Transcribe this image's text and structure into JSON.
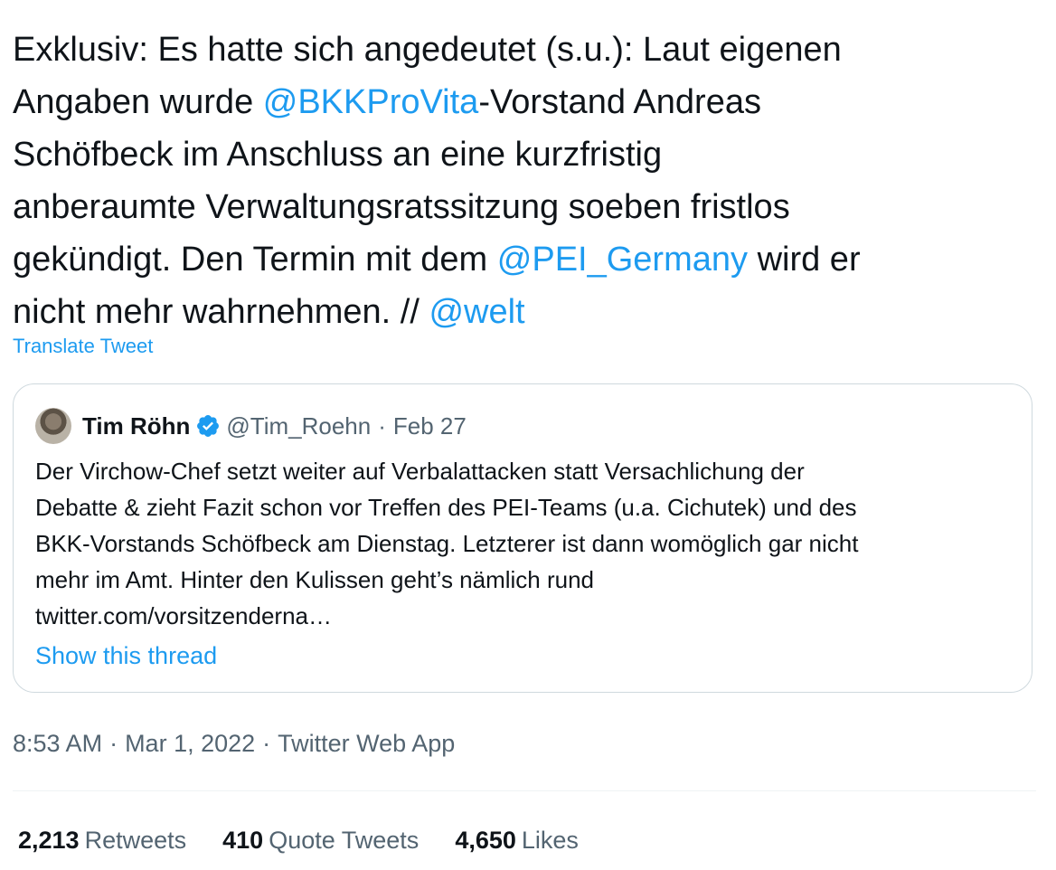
{
  "tweet": {
    "text_lines": [
      [
        {
          "t": "Exklusiv: Es hatte sich angedeutet (s.u.): Laut eigenen",
          "mention": false
        }
      ],
      [
        {
          "t": "Angaben wurde ",
          "mention": false
        },
        {
          "t": "@BKKProVita",
          "mention": true
        },
        {
          "t": "-Vorstand Andreas",
          "mention": false
        }
      ],
      [
        {
          "t": "Schöfbeck im Anschluss an eine kurzfristig",
          "mention": false
        }
      ],
      [
        {
          "t": "anberaumte Verwaltungsratssitzung soeben fristlos",
          "mention": false
        }
      ],
      [
        {
          "t": "gekündigt. Den Termin mit dem ",
          "mention": false
        },
        {
          "t": "@PEI_Germany",
          "mention": true
        },
        {
          "t": " wird er",
          "mention": false
        }
      ],
      [
        {
          "t": "nicht mehr wahrnehmen. // ",
          "mention": false
        },
        {
          "t": "@welt",
          "mention": true
        }
      ]
    ],
    "translate_label": "Translate Tweet"
  },
  "quote": {
    "name": "Tim Röhn",
    "handle": "@Tim_Roehn",
    "separator": "·",
    "date": "Feb 27",
    "verified_icon": "verified-badge-icon",
    "text_lines": [
      "Der Virchow-Chef setzt weiter auf Verbalattacken statt Versachlichung der",
      "Debatte & zieht Fazit schon vor Treffen des PEI-Teams (u.a. Cichutek) und des",
      "BKK-Vorstands Schöfbeck am Dienstag. Letzterer ist dann womöglich gar nicht",
      "mehr im Amt. Hinter den Kulissen geht’s nämlich rund",
      "twitter.com/vorsitzenderna…"
    ],
    "show_thread_label": "Show this thread"
  },
  "meta": {
    "time": "8:53 AM",
    "separator": "·",
    "date": "Mar 1, 2022",
    "source": "Twitter Web App"
  },
  "stats": [
    {
      "count": "2,213",
      "label": "Retweets"
    },
    {
      "count": "410",
      "label": "Quote Tweets"
    },
    {
      "count": "4,650",
      "label": "Likes"
    }
  ],
  "colors": {
    "accent": "#1d9bf0",
    "text": "#0f1419",
    "secondary": "#536471",
    "border": "#cfd9de"
  }
}
